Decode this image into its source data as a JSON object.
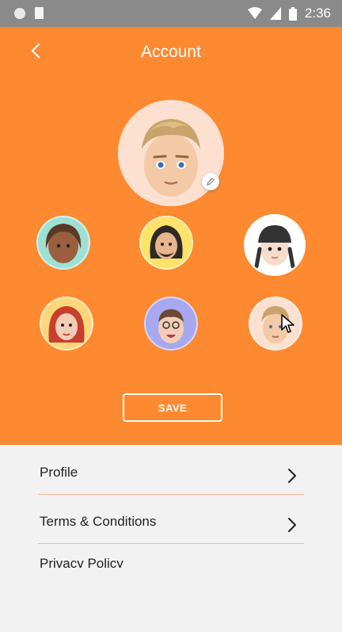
{
  "status_bar": {
    "time": "2:36"
  },
  "header": {
    "title": "Account"
  },
  "avatar": {
    "edit_icon": "pencil-icon"
  },
  "avatar_choices": [
    {
      "bg": "#9fe0d5"
    },
    {
      "bg": "#ffe26a"
    },
    {
      "bg": "#ffffff"
    },
    {
      "bg": "#ffd77a"
    },
    {
      "bg": "#a7a8f0"
    },
    {
      "bg": "#fde0cf"
    }
  ],
  "save_label": "SAVE",
  "menu": {
    "items": [
      {
        "label": "Profile"
      },
      {
        "label": "Terms & Conditions"
      },
      {
        "label": "Privacy Policy"
      }
    ]
  },
  "colors": {
    "accent": "#fd8930",
    "divider": "#f0b899"
  }
}
